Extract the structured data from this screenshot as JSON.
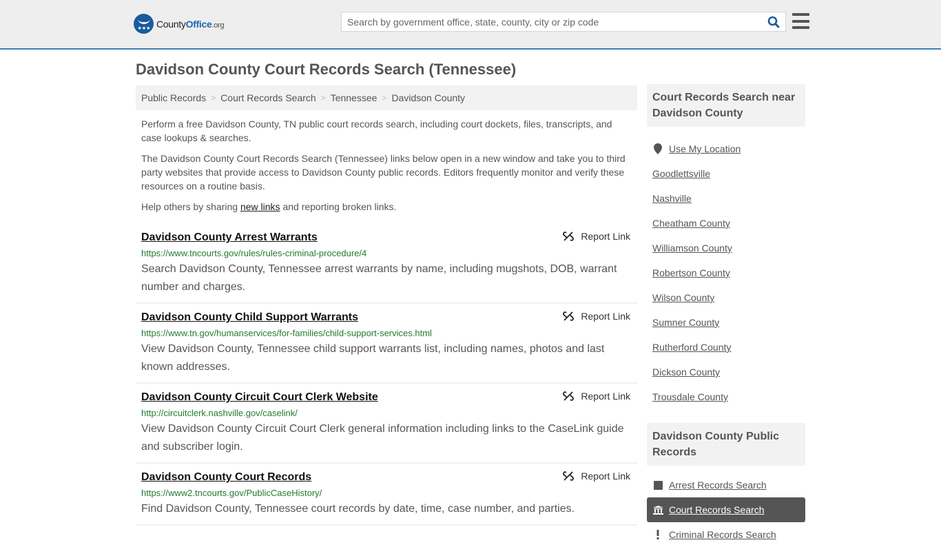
{
  "header": {
    "logo": {
      "name": "County",
      "office": "Office",
      "tld": ".org"
    },
    "search_placeholder": "Search by government office, state, county, city or zip code"
  },
  "page_title": "Davidson County Court Records Search (Tennessee)",
  "breadcrumb": [
    "Public Records",
    "Court Records Search",
    "Tennessee",
    "Davidson County"
  ],
  "intro": {
    "p1": "Perform a free Davidson County, TN public court records search, including court dockets, files, transcripts, and case lookups & searches.",
    "p2": "The Davidson County Court Records Search (Tennessee) links below open in a new window and take you to third party websites that provide access to Davidson County public records. Editors frequently monitor and verify these resources on a routine basis.",
    "p3_before": "Help others by sharing ",
    "p3_link": "new links",
    "p3_after": " and reporting broken links."
  },
  "report_label": "Report Link",
  "results": [
    {
      "title": "Davidson County Arrest Warrants",
      "url": "https://www.tncourts.gov/rules/rules-criminal-procedure/4",
      "desc": "Search Davidson County, Tennessee arrest warrants by name, including mugshots, DOB, warrant number and charges."
    },
    {
      "title": "Davidson County Child Support Warrants",
      "url": "https://www.tn.gov/humanservices/for-families/child-support-services.html",
      "desc": "View Davidson County, Tennessee child support warrants list, including names, photos and last known addresses."
    },
    {
      "title": "Davidson County Circuit Court Clerk Website",
      "url": "http://circuitclerk.nashville.gov/caselink/",
      "desc": "View Davidson County Circuit Court Clerk general information including links to the CaseLink guide and subscriber login."
    },
    {
      "title": "Davidson County Court Records",
      "url": "https://www2.tncourts.gov/PublicCaseHistory/",
      "desc": "Find Davidson County, Tennessee court records by date, time, case number, and parties."
    }
  ],
  "sidebar": {
    "nearby_heading": "Court Records Search near Davidson County",
    "use_location": "Use My Location",
    "nearby": [
      "Goodlettsville",
      "Nashville",
      "Cheatham County",
      "Williamson County",
      "Robertson County",
      "Wilson County",
      "Sumner County",
      "Rutherford County",
      "Dickson County",
      "Trousdale County"
    ],
    "public_heading": "Davidson County Public Records",
    "public_items": [
      {
        "label": "Arrest Records Search",
        "icon": "square-icon",
        "active": false
      },
      {
        "label": "Court Records Search",
        "icon": "courthouse-icon",
        "active": true
      },
      {
        "label": "Criminal Records Search",
        "icon": "exclamation-icon",
        "active": false
      }
    ]
  },
  "colors": {
    "accent": "#3a7eaf",
    "brand": "#1b5a9c",
    "url_green": "#247a32",
    "active_bg": "#555555"
  }
}
